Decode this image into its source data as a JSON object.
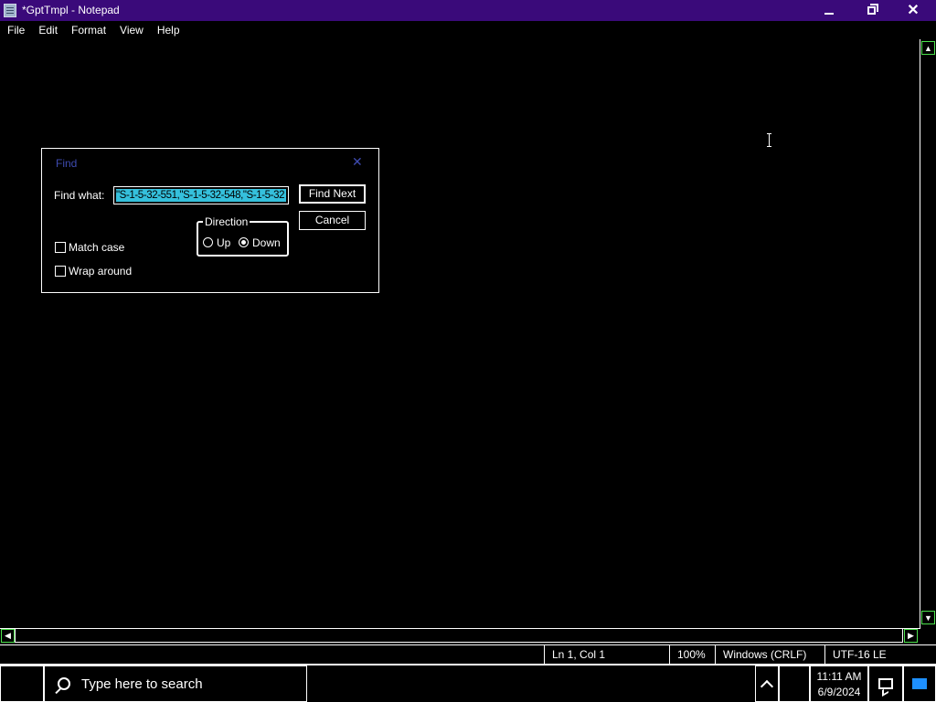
{
  "window": {
    "title": "*GptTmpl - Notepad",
    "icon": "notepad-icon",
    "controls": [
      "minimize",
      "maximize",
      "close"
    ]
  },
  "menu": {
    "items": [
      "File",
      "Edit",
      "Format",
      "View",
      "Help"
    ]
  },
  "find_dialog": {
    "title": "Find",
    "find_what_label": "Find what:",
    "find_what_value": "\"S-1-5-32-551,\"S-1-5-32-548,\"S-1-5-32",
    "find_next_label": "Find Next",
    "cancel_label": "Cancel",
    "direction_label": "Direction",
    "direction_up_label": "Up",
    "direction_down_label": "Down",
    "direction_selected": "Down",
    "match_case_label": "Match case",
    "match_case_checked": false,
    "wrap_around_label": "Wrap around",
    "wrap_around_checked": false
  },
  "status_bar": {
    "position": "Ln 1, Col 1",
    "zoom": "100%",
    "line_ending": "Windows (CRLF)",
    "encoding": "UTF-16 LE"
  },
  "taskbar": {
    "search_placeholder": "Type here to search",
    "time": "11:11 AM",
    "date": "6/9/2024"
  },
  "colors": {
    "title_bar": "#3a0a7a",
    "background": "#000000",
    "selection": "#35c0dc",
    "scroll_accent": "#4ce14c",
    "dialog_title": "#3e4bb0"
  }
}
